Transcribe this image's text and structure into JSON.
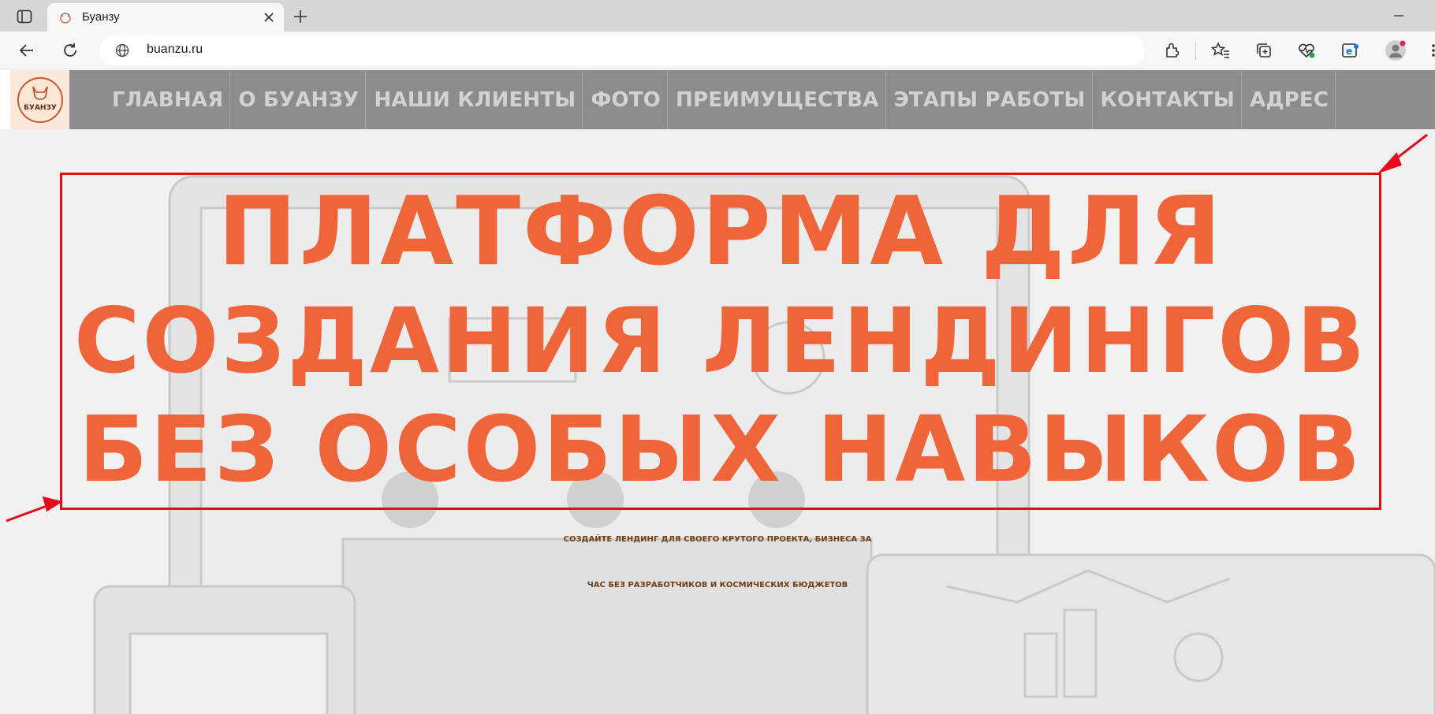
{
  "browser": {
    "tab": {
      "title": "Буанзу"
    },
    "address": {
      "url": "buanzu.ru"
    }
  },
  "site": {
    "logo_text": "БУАНЗУ",
    "nav": [
      "ГЛАВНАЯ",
      "О БУАНЗУ",
      "НАШИ КЛИЕНТЫ",
      "ФОТО",
      "ПРЕИМУЩЕСТВА",
      "ЭТАПЫ РАБОТЫ",
      "КОНТАКТЫ",
      "АДРЕС"
    ],
    "hero": {
      "headline": [
        "ПЛАТФОРМА ДЛЯ",
        "СОЗДАНИЯ ЛЕНДИНГОВ",
        "БЕЗ ОСОБЫХ НАВЫКОВ"
      ],
      "subtitle": [
        "СОЗДАЙТЕ ЛЕНДИНГ ДЛЯ СВОЕГО КРУТОГО ПРОЕКТА, БИЗНЕСА ЗА",
        "ЧАС БЕЗ РАЗРАБОТЧИКОВ И КОСМИЧЕСКИХ БЮДЖЕТОВ"
      ]
    }
  },
  "colors": {
    "headline": "#f0643a",
    "subtitle": "#6e3d14",
    "annotation": "#e30b1c",
    "nav_bg": "#8c8c8c"
  },
  "icons": [
    "tab-actions-icon",
    "favicon-icon",
    "close-icon",
    "plus-icon",
    "minimize-icon",
    "back-arrow-icon",
    "refresh-icon",
    "globe-icon",
    "extensions-icon",
    "favorites-icon",
    "collections-icon",
    "health-icon",
    "ie-mode-icon",
    "profile-icon",
    "more-icon"
  ]
}
